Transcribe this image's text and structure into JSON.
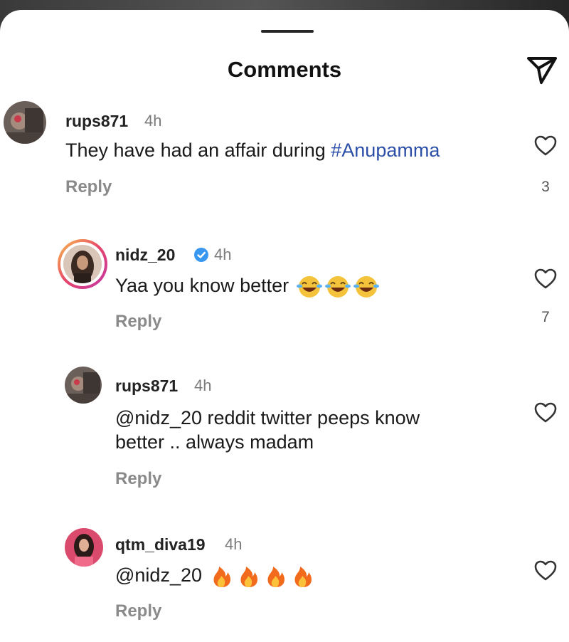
{
  "header": {
    "title": "Comments"
  },
  "comments": [
    {
      "username": "rups871",
      "time": "4h",
      "text": "They have had an affair during ",
      "hashtag": "#Anupamma",
      "reply_label": "Reply",
      "likes": "3"
    },
    {
      "username": "nidz_20",
      "time": "4h",
      "text": "Yaa you know better",
      "reply_label": "Reply",
      "likes": "7"
    },
    {
      "username": "rups871",
      "time": "4h",
      "mention": "@nidz_20",
      "text_line1": " reddit twitter peeps know",
      "text_line2": "better .. always madam",
      "reply_label": "Reply"
    },
    {
      "username": "qtm_diva19",
      "time": "4h",
      "mention": "@nidz_20",
      "reply_label": "Reply"
    }
  ],
  "icons": {
    "send": "paper-plane-icon",
    "like": "heart-icon",
    "verified": "verified-badge-icon",
    "laugh": "face-with-tears-of-joy-icon",
    "fire": "fire-icon"
  },
  "colors": {
    "hashtag": "#2b4ea7",
    "verified": "#3897f0"
  }
}
